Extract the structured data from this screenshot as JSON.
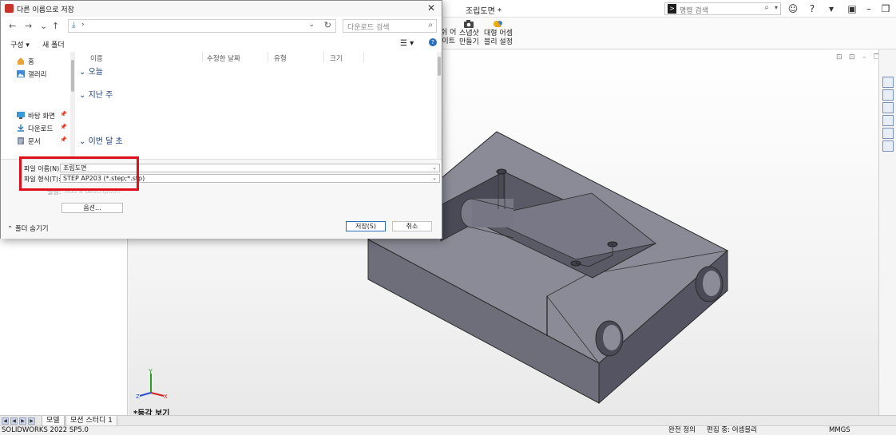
{
  "app": {
    "doc_title": "조립도면 *",
    "command_search_placeholder": "명령 검색",
    "status": {
      "version": "SOLIDWORKS 2022 SP5.0",
      "fully_defined": "완전 정의",
      "editing": "편집 중: 어셈블리",
      "units": "MMGS"
    },
    "tabs": [
      "모델",
      "모션 스터디 1"
    ],
    "view_label": "*등각 보기"
  },
  "ribbon": {
    "partial_label_1": "쉬 어",
    "partial_label_2": "이트",
    "snapshot_label_1": "스냅샷",
    "snapshot_label_2": "만들기",
    "large_assembly_label_1": "대형 어셈",
    "large_assembly_label_2": "블리 설정"
  },
  "dialog": {
    "title": "다른 이름으로 저장",
    "address_chevron": "›",
    "search_placeholder": "다운로드 검색",
    "organize_label": "구성 ▾",
    "new_folder_label": "새 폴더",
    "nav_items": [
      {
        "label": "홈",
        "icon": "home-icon"
      },
      {
        "label": "갤러리",
        "icon": "gallery-icon"
      },
      {
        "label": "바탕 화면",
        "icon": "desktop-icon"
      },
      {
        "label": "다운로드",
        "icon": "download-icon"
      },
      {
        "label": "문서",
        "icon": "document-icon"
      }
    ],
    "columns": [
      "이름",
      "수정한 날짜",
      "유형",
      "크기"
    ],
    "groups": [
      "오늘",
      "지난 주",
      "이번 달 초"
    ],
    "file_name_label": "파일 이름(N):",
    "file_name_value": "조립도면",
    "file_type_label": "파일 형식(T):",
    "file_type_value": "STEP AP203 (*.step;*.stp)",
    "author_label": "설명:",
    "author_value": "Add a description",
    "options_button": "옵션...",
    "hide_folders": "폴더 숨기기",
    "save_button": "저장(S)",
    "cancel_button": "취소"
  },
  "colors": {
    "highlight": "#e0101a",
    "part_fill": "#6c6c78",
    "accent": "#2a6ebc"
  }
}
